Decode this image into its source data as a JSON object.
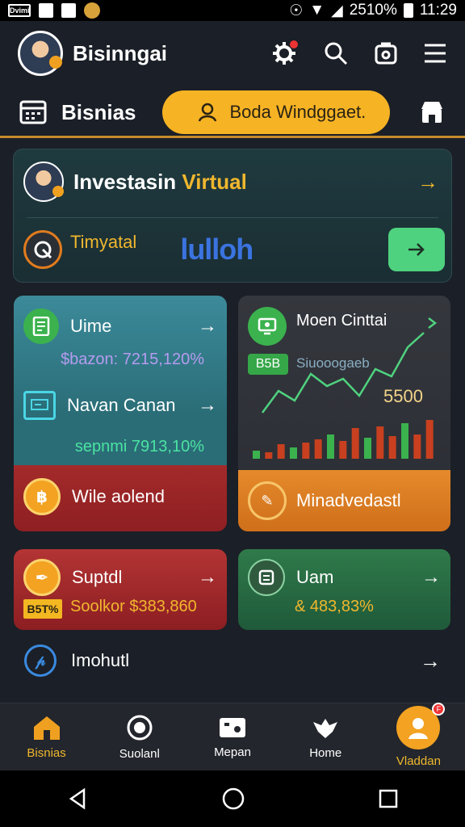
{
  "status_bar": {
    "left_box_label": "Dvimi",
    "battery_percent": "2510%",
    "time": "11:29"
  },
  "header": {
    "title": "Bisinngai",
    "icons": [
      "settings-gear-icon",
      "search-icon",
      "wallet-icon",
      "menu-icon"
    ]
  },
  "subheader": {
    "title": "Bisnias",
    "search_label": "Boda Windggaet."
  },
  "invest_card": {
    "title_part1": "Investasin",
    "title_part2": "Virtual",
    "tiny_label": "Timyatal",
    "highlight_text": "lulloh"
  },
  "tiles": {
    "teal": {
      "row1_label": "Uime",
      "row1_stat": "$bazon: 7215,120%",
      "row2_label": "Navan Canan",
      "row2_stat": "sepnmi 7913,10%",
      "footer_label": "Wile&nbsp;aolend"
    },
    "chart": {
      "title": "Moen Cinttai",
      "pill": "B5B",
      "small": "Siuooogaeb",
      "big_value": "5500",
      "footer_label": "Minadvedastl"
    },
    "red": {
      "label": "Suptdl",
      "tag": "B5T%",
      "stat": "Soolkor $383,860"
    },
    "green": {
      "label": "Uam",
      "stat": "& 483,83%"
    }
  },
  "list_row": {
    "label": "Imohutl"
  },
  "bottom_nav": {
    "items": [
      {
        "label": "Bisnias",
        "active": true
      },
      {
        "label": "Suolanl",
        "active": false
      },
      {
        "label": "Mepan",
        "active": false
      },
      {
        "label": "Home",
        "active": false
      },
      {
        "label": "Vladdan",
        "active": true
      }
    ],
    "badge": "F"
  },
  "chart_data": {
    "type": "bar",
    "values": [
      10,
      8,
      18,
      14,
      20,
      24,
      30,
      22,
      38,
      26,
      40,
      28,
      44,
      30,
      48
    ],
    "line_values": [
      30,
      48,
      40,
      62,
      52,
      58,
      44,
      66,
      60,
      84,
      96
    ],
    "big_value": "5500"
  },
  "colors": {
    "accent": "#f0b72e",
    "teal": "#2a6d77",
    "green": "#3bb24e",
    "red": "#a42a2a",
    "orange": "#e58a2b"
  }
}
